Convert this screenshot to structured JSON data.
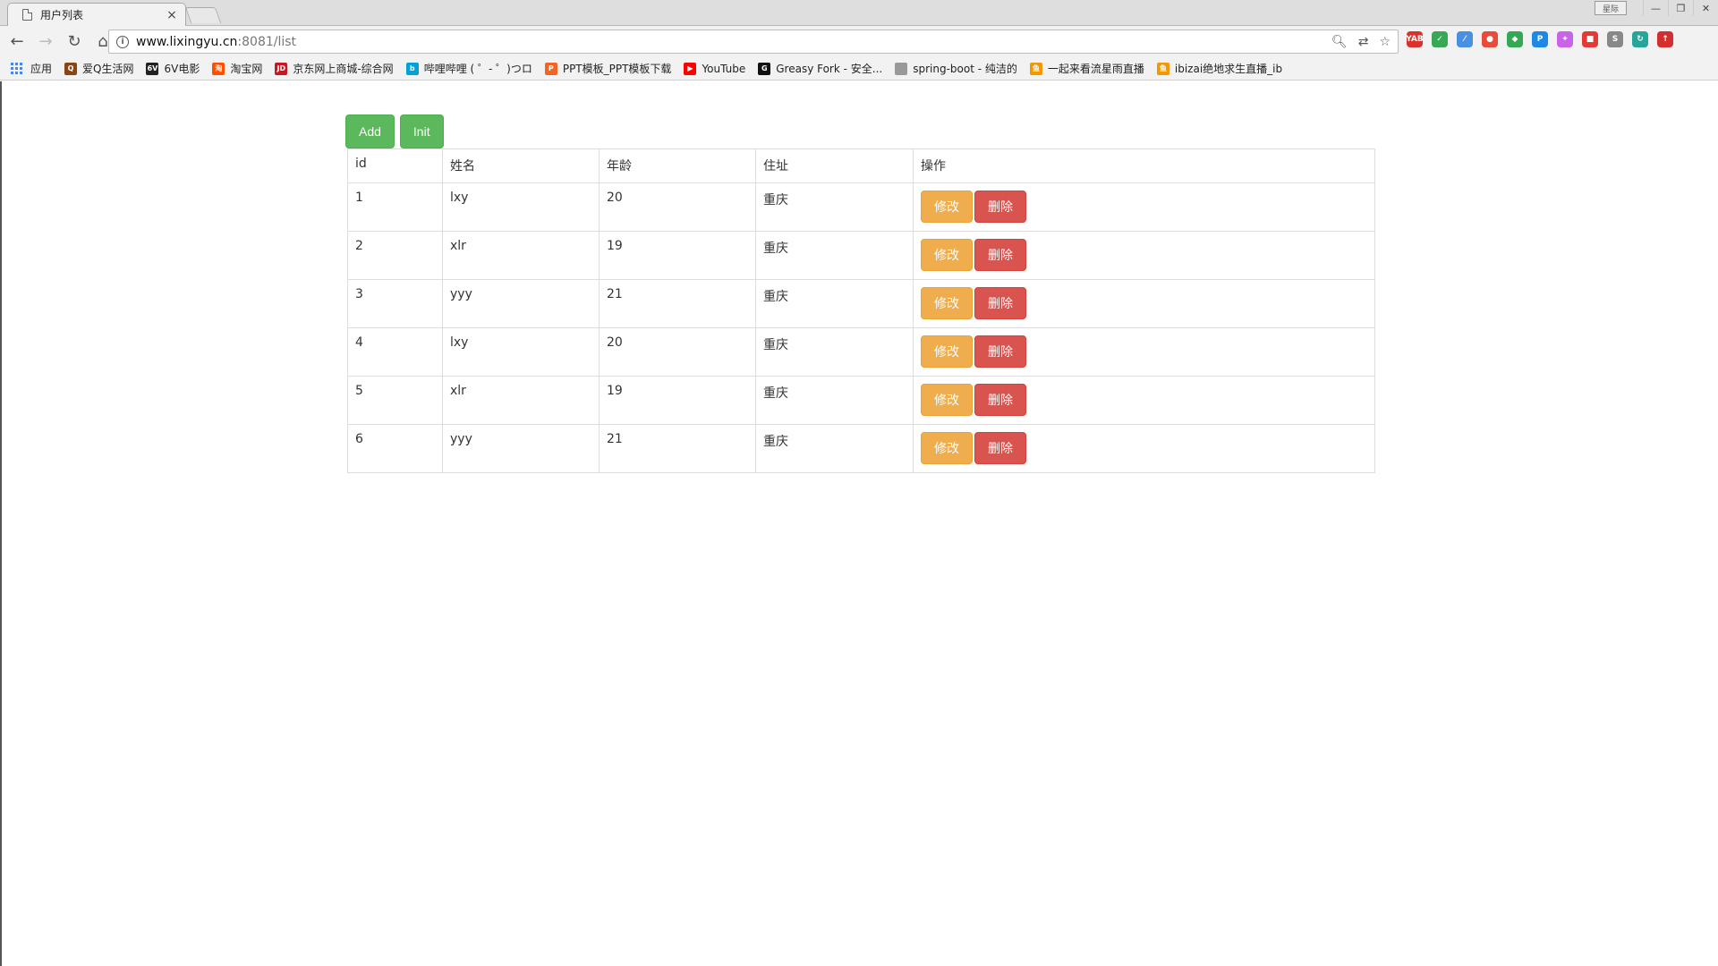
{
  "browser": {
    "tab_title": "用户列表",
    "tab_close": "×",
    "url_host": "www.lixingyu.cn",
    "url_path": ":8081/list",
    "window_user": "星际",
    "bookmarks": [
      {
        "label": "应用",
        "icon": "apps-icon",
        "color": "#4285f4",
        "glyph": ""
      },
      {
        "label": "爱Q生活网",
        "icon": "lion-icon",
        "color": "#8b4513",
        "glyph": "Q"
      },
      {
        "label": "6V电影",
        "icon": "6v-icon",
        "color": "#222222",
        "glyph": "6V"
      },
      {
        "label": "淘宝网",
        "icon": "taobao-icon",
        "color": "#ff5000",
        "glyph": "淘"
      },
      {
        "label": "京东网上商城-综合网",
        "icon": "jd-icon",
        "color": "#c81623",
        "glyph": "JD"
      },
      {
        "label": "哔哩哔哩 ( ゜- ゜)つロ",
        "icon": "bilibili-icon",
        "color": "#00a1d6",
        "glyph": "b"
      },
      {
        "label": "PPT模板_PPT模板下载",
        "icon": "ppt-icon",
        "color": "#f26522",
        "glyph": "P"
      },
      {
        "label": "YouTube",
        "icon": "youtube-icon",
        "color": "#ff0000",
        "glyph": "▶"
      },
      {
        "label": "Greasy Fork - 安全...",
        "icon": "greasyfork-icon",
        "color": "#111111",
        "glyph": "G"
      },
      {
        "label": "spring-boot - 纯洁的",
        "icon": "page-icon",
        "color": "#999999",
        "glyph": ""
      },
      {
        "label": "一起来看流星雨直播",
        "icon": "douyu-icon",
        "color": "#f39800",
        "glyph": "鱼"
      },
      {
        "label": "ibizai绝地求生直播_ib",
        "icon": "douyu-icon",
        "color": "#f39800",
        "glyph": "鱼"
      }
    ],
    "extensions": [
      {
        "name": "yab-icon",
        "color": "#d9322e",
        "glyph": "YAB"
      },
      {
        "name": "shield-icon",
        "color": "#3aa757",
        "glyph": "✓"
      },
      {
        "name": "feather-icon",
        "color": "#4a90e2",
        "glyph": "⁄"
      },
      {
        "name": "maps-pin-icon",
        "color": "#e74c3c",
        "glyph": "●"
      },
      {
        "name": "chrome-ext-icon",
        "color": "#34a853",
        "glyph": "◆"
      },
      {
        "name": "key-icon",
        "color": "#1e88e5",
        "glyph": "P"
      },
      {
        "name": "sparkle-icon",
        "color": "#c964e8",
        "glyph": "✦"
      },
      {
        "name": "tabs-icon",
        "color": "#e53935",
        "glyph": "■"
      },
      {
        "name": "s-icon",
        "color": "#888888",
        "glyph": "S"
      },
      {
        "name": "sync-icon",
        "color": "#26a69a",
        "glyph": "↻"
      },
      {
        "name": "upload-icon",
        "color": "#d32f2f",
        "glyph": "↑"
      }
    ]
  },
  "page": {
    "add_label": "Add",
    "init_label": "Init",
    "columns": [
      "id",
      "姓名",
      "年龄",
      "住址",
      "操作"
    ],
    "rows": [
      {
        "id": "1",
        "name": "lxy",
        "age": "20",
        "address": "重庆"
      },
      {
        "id": "2",
        "name": "xlr",
        "age": "19",
        "address": "重庆"
      },
      {
        "id": "3",
        "name": "yyy",
        "age": "21",
        "address": "重庆"
      },
      {
        "id": "4",
        "name": "lxy",
        "age": "20",
        "address": "重庆"
      },
      {
        "id": "5",
        "name": "xlr",
        "age": "19",
        "address": "重庆"
      },
      {
        "id": "6",
        "name": "yyy",
        "age": "21",
        "address": "重庆"
      }
    ],
    "edit_label": "修改",
    "delete_label": "删除",
    "colors": {
      "success": "#5cb85c",
      "warning": "#f0ad4e",
      "danger": "#d9534f"
    }
  }
}
